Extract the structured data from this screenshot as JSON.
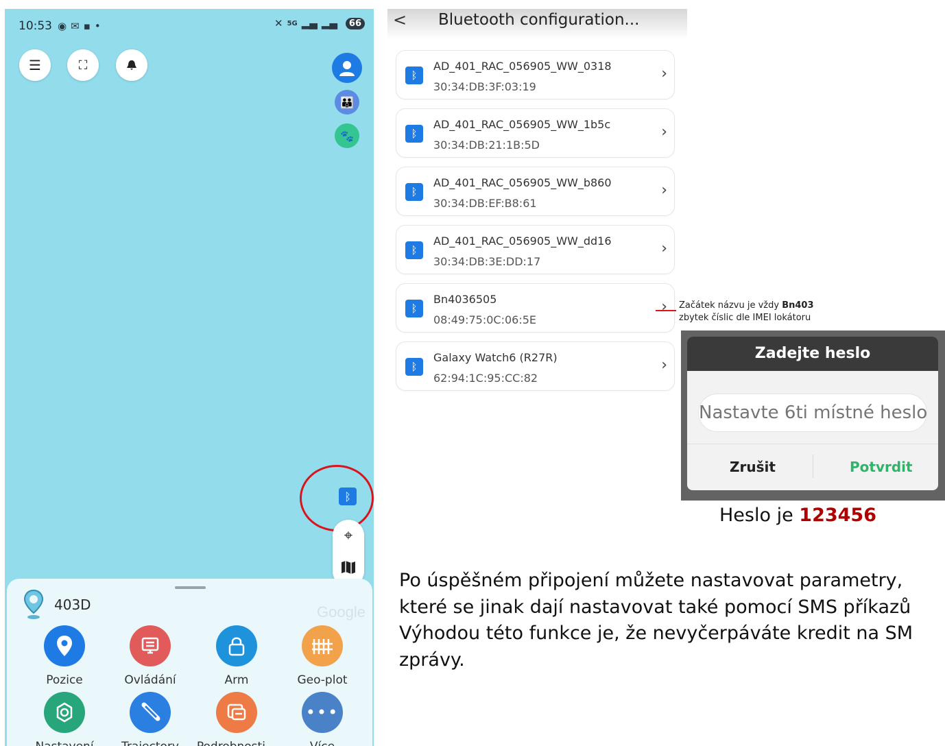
{
  "phone": {
    "status": {
      "time": "10:53",
      "left_icons": [
        "messenger-icon",
        "gmail-icon",
        "app-icon",
        "dot"
      ],
      "network_label": "5G",
      "battery": "66"
    },
    "top_buttons": [
      "menu-icon",
      "scan-icon",
      "alarm-icon"
    ],
    "device_name": "403D",
    "google_text": "Google",
    "functions": [
      {
        "label": "Pozice",
        "icon": "location-pin-icon",
        "color": "#1e7be4"
      },
      {
        "label": "Ovládání",
        "icon": "control-panel-icon",
        "color": "#e25b5b"
      },
      {
        "label": "Arm",
        "icon": "lock-icon",
        "color": "#1e93dc"
      },
      {
        "label": "Geo-plot",
        "icon": "fence-icon",
        "color": "#f2a24a"
      },
      {
        "label": "Nastavení",
        "icon": "settings-icon",
        "color": "#27a57b"
      },
      {
        "label": "Trajectory",
        "icon": "route-icon",
        "color": "#2a7fe0"
      },
      {
        "label": "Podrobnosti...",
        "icon": "details-icon",
        "color": "#ee7a45"
      },
      {
        "label": "Více",
        "icon": "more-icon",
        "color": "#4a82c8"
      }
    ]
  },
  "bt_list": {
    "title": "Bluetooth configuration...",
    "devices": [
      {
        "name": "AD_401_RAC_056905_WW_0318",
        "mac": "30:34:DB:3F:03:19"
      },
      {
        "name": "AD_401_RAC_056905_WW_1b5c",
        "mac": "30:34:DB:21:1B:5D"
      },
      {
        "name": "AD_401_RAC_056905_WW_b860",
        "mac": "30:34:DB:EF:B8:61"
      },
      {
        "name": "AD_401_RAC_056905_WW_dd16",
        "mac": "30:34:DB:3E:DD:17"
      },
      {
        "name": "Bn4036505",
        "mac": "08:49:75:0C:06:5E"
      },
      {
        "name": "Galaxy Watch6 (R27R)",
        "mac": "62:94:1C:95:CC:82"
      }
    ]
  },
  "note": {
    "line1_prefix": "Začátek názvu je vždy ",
    "line1_bold": "Bn403",
    "line2": "zbytek číslic dle IMEI lokátoru"
  },
  "dialog": {
    "title": "Zadejte heslo",
    "placeholder": "Nastavte 6ti místné heslo",
    "cancel": "Zrušit",
    "confirm": "Potvrdit"
  },
  "password_hint": {
    "prefix": "Heslo je ",
    "value": "123456"
  },
  "paragraph": "Po úspěšném připojení můžete nastavovat parametry,\nkteré se jinak dají nastavovat také pomocí SMS příkazů\nVýhodou této funkce je, že nevyčerpáváte kredit na SM\nzprávy.",
  "colors": {
    "map_background": "#92dcec",
    "accent_blue": "#1e7be4",
    "confirm_green": "#2fb56a",
    "highlight_red": "#d8141d"
  }
}
